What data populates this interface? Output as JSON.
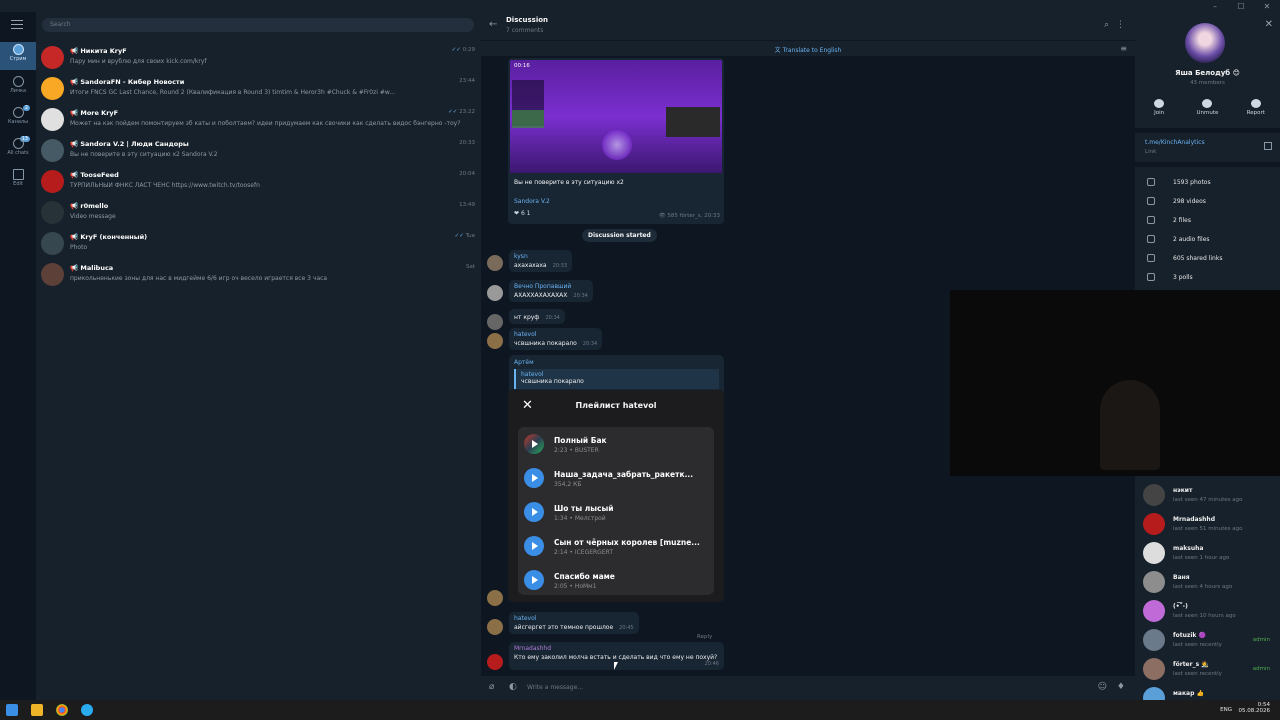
{
  "window": {
    "minimize": "–",
    "maximize": "☐",
    "close": "✕"
  },
  "rail": {
    "items": [
      {
        "label": "Стрим"
      },
      {
        "label": "Личка"
      },
      {
        "label": "Каналы",
        "badge": "2"
      },
      {
        "label": "All chats",
        "badge": "13"
      },
      {
        "label": "Edit"
      }
    ]
  },
  "search": {
    "placeholder": "Search"
  },
  "chats": [
    {
      "name": "Никита KryF",
      "preview": "Пару мин и врублю для своих  kick.com/kryf",
      "time": "0:29",
      "read": true,
      "color": "#c62828"
    },
    {
      "name": "SandoraFN - Кибер Новости",
      "preview": "Итоги FNCS GC Last Chance, Round 2 (Квалификация в Round 3)  timtim & Heror3h  #Chuck & #Fr0zi  #w...",
      "time": "23:44",
      "read": false,
      "color": "#f9a825"
    },
    {
      "name": "More KryF",
      "preview": "Может на кэк пойдем помонтируем зб каты и поболтаем? идеи придумаем как свочики как сделать видос бэнгерно -тоу?",
      "time": "23:22",
      "read": true,
      "color": "#e0e0e0"
    },
    {
      "name": "Sandora V.2 | Люди Сандоры",
      "preview": "Вы не поверите в эту ситуацию x2  Sandora V.2",
      "time": "20:33",
      "read": false,
      "color": "#455a64"
    },
    {
      "name": "TooseFeed",
      "preview": "ТУРПИЛЬНЫЙ ФНКС ЛАСТ ЧЕНС  https://www.twitch.tv/toosefn",
      "time": "20:04",
      "read": false,
      "color": "#b71c1c"
    },
    {
      "name": "r0mello",
      "preview": "Video message",
      "time": "13:49",
      "read": false,
      "color": "#263238"
    },
    {
      "name": "KryF (конченный)",
      "preview": "Photo",
      "time": "Tue",
      "read": true,
      "color": "#37474f"
    },
    {
      "name": "Malibuca",
      "preview": "прикольненькие зоны для нас в мидгейме 6/6 игр оч весело играется все 3 часа",
      "time": "Sat",
      "read": false,
      "color": "#5d4037"
    }
  ],
  "chat": {
    "title": "Discussion",
    "subtitle": "7 comments",
    "translate": "Translate to English",
    "post": {
      "timecode": "00:16",
      "caption": "Вы не поверите в эту ситуацию x2",
      "channel": "Sandora V.2",
      "reactions": "6    1",
      "views": "585",
      "author_time": "förter_s, 20:33"
    },
    "separator": "Discussion started",
    "messages": [
      {
        "from": "kysn",
        "text": "ахахахаха",
        "time": "20:33",
        "color": "#6ab3f3",
        "avatar": "#7a6a5a"
      },
      {
        "from": "Вечно Пропавший",
        "text": "АХАХХАХАХАХАХ",
        "time": "20:34",
        "color": "#6ab3f3",
        "avatar": "#999999"
      },
      {
        "from": "",
        "text": "нт круф",
        "time": "20:34",
        "color": "#6ab3f3",
        "avatar": "#666"
      },
      {
        "from": "hatevol",
        "text": "чсвшника покарало",
        "time": "20:34",
        "color": "#6ab3f3",
        "avatar": "#8b6f47"
      }
    ],
    "reply": {
      "from": "Артём",
      "quote_name": "hatevol",
      "quote_text": "чсвшника покарало"
    },
    "later": [
      {
        "from": "hatevol",
        "text": "айсгергет это темное прошлое",
        "time": "20:45",
        "color": "#6ab3f3"
      },
      {
        "from": "Mrnadashhd",
        "text": "Кто ему заколил молча встать и сделать вид что ему не похуй?",
        "time": "20:46",
        "color": "#b07cd8"
      }
    ],
    "reply_hint": "Reply",
    "composer_placeholder": "Write a message..."
  },
  "playlist": {
    "title": "Плейлист hatevol",
    "close": "✕",
    "tracks": [
      {
        "name": "Полный Бак",
        "meta": "2:23 • BUSTER",
        "cover": true
      },
      {
        "name": "Наша_задача_забрать_ракетк...",
        "meta": "354,2 КБ",
        "cover": false
      },
      {
        "name": "Шо ты лысый",
        "meta": "1:34 • Мелстрой",
        "cover": false
      },
      {
        "name": "Сын от чёрных королев [muzne...",
        "meta": "2:14 • ICEGERGERT",
        "cover": false
      },
      {
        "name": "Спасибо маме",
        "meta": "2:05 • НоМм1",
        "cover": false
      }
    ]
  },
  "info": {
    "name": "Яша Белодуб 😊",
    "members": "43 members",
    "actions": [
      "Join",
      "Unmute",
      "Report"
    ],
    "link": "t.me/KinchAnalytics",
    "link_label": "Link",
    "stats": [
      "1593 photos",
      "298 videos",
      "2 files",
      "2 audio files",
      "605 shared links",
      "3 polls"
    ]
  },
  "member_list": [
    {
      "name": "нэкит",
      "status": "last seen 47 minutes ago",
      "role": "",
      "color": "#444"
    },
    {
      "name": "Mrnadashhd",
      "status": "last seen 51 minutes ago",
      "role": "",
      "color": "#b71c1c"
    },
    {
      "name": "maksuha",
      "status": "last seen 1 hour ago",
      "role": "",
      "color": "#ddd"
    },
    {
      "name": "Ваня",
      "status": "last seen 4 hours ago",
      "role": "",
      "color": "#8d8d8d"
    },
    {
      "name": "(•͡˘-)",
      "status": "last seen 10 hours ago",
      "role": "",
      "color": "#c06ad8"
    },
    {
      "name": "fotuzik 🟣",
      "status": "last seen recently",
      "role": "admin",
      "color": "#6a7a8a"
    },
    {
      "name": "förter_s 🧑‍🎨",
      "status": "last seen recently",
      "role": "admin",
      "color": "#8d6e63"
    },
    {
      "name": "макар 👍",
      "status": "",
      "role": "",
      "color": "#5b9fd8"
    }
  ],
  "taskbar": {
    "lang": "ENG",
    "time": "0:54",
    "date": "05.08.2026"
  }
}
